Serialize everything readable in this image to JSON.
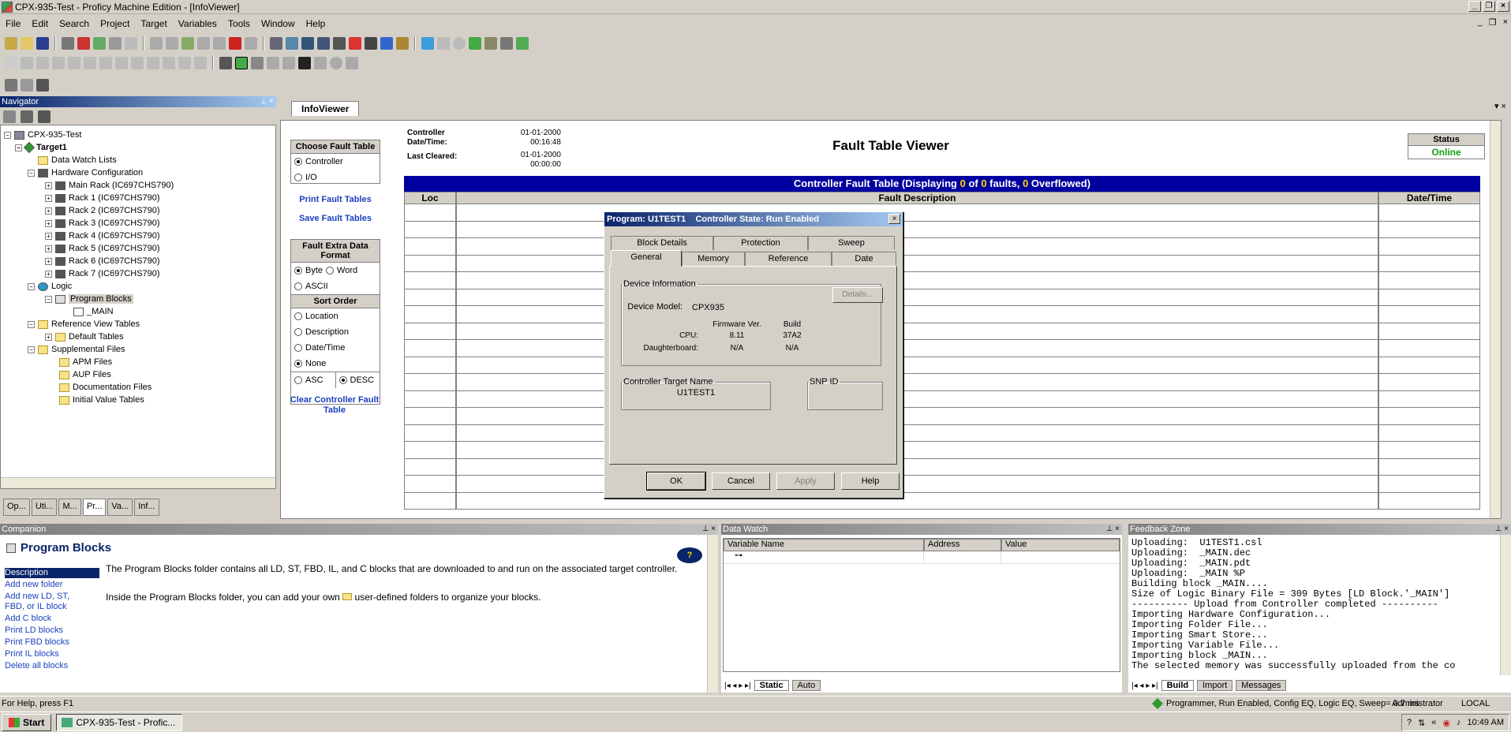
{
  "window": {
    "title": "CPX-935-Test - Proficy Machine Edition - [InfoViewer]"
  },
  "menu": [
    "File",
    "Edit",
    "Search",
    "Project",
    "Target",
    "Variables",
    "Tools",
    "Window",
    "Help"
  ],
  "navigator": {
    "title": "Navigator",
    "tree": {
      "root": "CPX-935-Test",
      "target": "Target1",
      "data_watch": "Data Watch Lists",
      "hw_config": "Hardware Configuration",
      "racks": [
        "Main Rack (IC697CHS790)",
        "Rack 1 (IC697CHS790)",
        "Rack 2 (IC697CHS790)",
        "Rack 3 (IC697CHS790)",
        "Rack 4 (IC697CHS790)",
        "Rack 5 (IC697CHS790)",
        "Rack 6 (IC697CHS790)",
        "Rack 7 (IC697CHS790)"
      ],
      "logic": "Logic",
      "program_blocks": "Program Blocks",
      "main": "_MAIN",
      "ref_view": "Reference View Tables",
      "default_tables": "Default Tables",
      "supplemental": "Supplemental Files",
      "supp_items": [
        "APM Files",
        "AUP Files",
        "Documentation Files",
        "Initial Value Tables"
      ]
    },
    "tabs": [
      "Op...",
      "Uti...",
      "M...",
      "Pr...",
      "Va...",
      "Inf..."
    ]
  },
  "infoviewer": {
    "tab": "InfoViewer",
    "choose_fault_table": "Choose Fault Table",
    "opt_controller": "Controller",
    "opt_io": "I/O",
    "print_fault_tables": "Print Fault Tables",
    "save_fault_tables": "Save Fault Tables",
    "extra_format_hdr": "Fault Extra Data Format",
    "opt_byte": "Byte",
    "opt_word": "Word",
    "opt_ascii": "ASCII",
    "sort_order": "Sort Order",
    "opt_location": "Location",
    "opt_description": "Description",
    "opt_datetime": "Date/Time",
    "opt_none": "None",
    "opt_asc": "ASC",
    "opt_desc": "DESC",
    "clear_controller": "Clear Controller Fault Table",
    "ctrl_datetime_label": "Controller Date/Time:",
    "ctrl_datetime_value": "01-01-2000 00:16:48",
    "last_cleared_label": "Last Cleared:",
    "last_cleared_value": "01-01-2000 00:00:00",
    "viewer_title": "Fault Table Viewer",
    "status_label": "Status",
    "status_value": "Online",
    "banner_prefix": "Controller Fault Table (Displaying ",
    "banner_shown": "0",
    "banner_of": " of ",
    "banner_total": "0",
    "banner_mid": " faults, ",
    "banner_overflow": "0",
    "banner_suffix": " Overflowed)",
    "col_loc": "Loc",
    "col_desc": "Fault Description",
    "col_date": "Date/Time"
  },
  "dialog": {
    "title": "Program: U1TEST1    Controller State: Run Enabled",
    "tabs_back": [
      "Block Details",
      "Protection",
      "Sweep"
    ],
    "tabs_front": [
      "General",
      "Memory",
      "Reference",
      "Date"
    ],
    "device_info": "Device Information",
    "details_btn": "Details...",
    "device_model_label": "Device Model:",
    "device_model": "CPX935",
    "firmware_hdr": "Firmware Ver.",
    "build_hdr": "Build",
    "cpu_label": "CPU:",
    "cpu_fw": "8.11",
    "cpu_build": "37A2",
    "db_label": "Daughterboard:",
    "db_fw": "N/A",
    "db_build": "N/A",
    "target_name_label": "Controller Target Name",
    "target_name": "U1TEST1",
    "snp_label": "SNP ID",
    "ok": "OK",
    "cancel": "Cancel",
    "apply": "Apply",
    "help": "Help"
  },
  "companion": {
    "title": "Companion",
    "heading": "Program Blocks",
    "links": [
      "Description",
      "Add new folder",
      "Add new LD, ST, FBD, or IL block",
      "Add C block",
      "Print LD blocks",
      "Print FBD blocks",
      "Print IL blocks",
      "Delete all blocks"
    ],
    "text1": "The Program Blocks folder contains all LD, ST, FBD, IL, and C blocks that are downloaded to and run on the associated target controller.",
    "text2a": "Inside the Program Blocks folder, you can add your own ",
    "text2b": " user-defined folders to organize your blocks."
  },
  "datawatch": {
    "title": "Data Watch",
    "cols": [
      "Variable Name",
      "Address",
      "Value"
    ],
    "tabs": [
      "Static",
      "Auto"
    ]
  },
  "feedback": {
    "title": "Feedback Zone",
    "lines": [
      "Uploading:  U1TEST1.csl",
      "Uploading:  _MAIN.dec",
      "Uploading:  _MAIN.pdt",
      "Uploading:  _MAIN %P",
      "Building block _MAIN....",
      "Size of Logic Binary File = 309 Bytes [LD Block.'_MAIN']",
      "---------- Upload from Controller completed ----------",
      "Importing Hardware Configuration...",
      "Importing Folder File...",
      "Importing Smart Store...",
      "Importing Variable File...",
      "Importing block _MAIN...",
      "The selected memory was successfully uploaded from the co"
    ],
    "tabs": [
      "Build",
      "Import",
      "Messages"
    ]
  },
  "statusbar": {
    "help": "For Help, press F1",
    "state": "Programmer, Run Enabled, Config EQ, Logic EQ, Sweep= 0.7 ms",
    "user": "Administrator",
    "locality": "LOCAL"
  },
  "taskbar": {
    "start": "Start",
    "task": "CPX-935-Test - Profic...",
    "clock": "10:49 AM"
  }
}
